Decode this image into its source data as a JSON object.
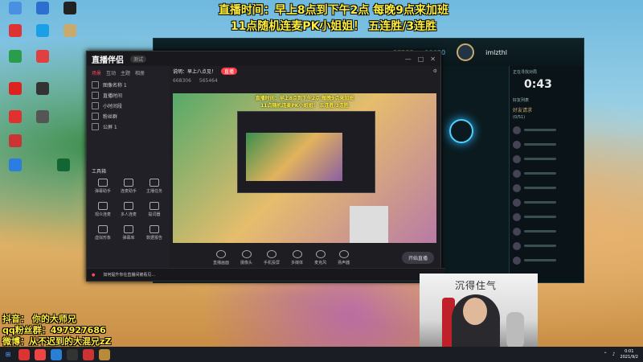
{
  "banner": {
    "line1": "直播时间：早上8点到下午2点   每晚9点来加班",
    "line2": "11点随机连麦PK小姐姐！  五连胜/3连胜"
  },
  "streamer_info": {
    "douyin": "抖音：   你的大师兄",
    "qq_group": "qq粉丝群：497927686",
    "weibo": "微博：从不迟到的大混兄zZ"
  },
  "lol_client": {
    "currency_rp": "27585",
    "currency_be": "19620",
    "username": "imlzthl",
    "queue_timer": "0:43",
    "queue_label": "正在寻找对局",
    "friends_label": "好友列表",
    "friends_group": "好友请求",
    "online_count": "(0/51)"
  },
  "live_app": {
    "logo": "直播伴侣",
    "version": "测试",
    "room_title": "说明：早上八点见！",
    "room_tag": "直播",
    "sidebar_tabs": [
      "场景",
      "互动",
      "主题",
      "相册"
    ],
    "scenes": [
      {
        "label": "图像名称 1"
      },
      {
        "label": "直播时间"
      },
      {
        "label": "小时间段"
      },
      {
        "label": "粉丝群"
      },
      {
        "label": "公屏 1"
      }
    ],
    "tools_title": "工具箱",
    "tools": [
      {
        "label": "弹幕助手"
      },
      {
        "label": "连麦助手"
      },
      {
        "label": "主播任务"
      },
      {
        "label": "观众连麦"
      },
      {
        "label": "多人连麦"
      },
      {
        "label": "提词器"
      },
      {
        "label": "虚拟形象"
      },
      {
        "label": "弹幕库"
      },
      {
        "label": "数据报告"
      }
    ],
    "stats": {
      "followers": "668306",
      "viewers": "565464"
    },
    "bottom_buttons": [
      "直播画面",
      "摄像头",
      "手机投屏",
      "多媒体",
      "麦克风",
      "扬声器"
    ],
    "start_label": "开始直播",
    "status_notice": "如何提升你在直播间被看见..."
  },
  "cam": {
    "calligraphy": "沉得住气"
  },
  "taskbar": {
    "time": "0:01",
    "date": "2021/9/2"
  }
}
